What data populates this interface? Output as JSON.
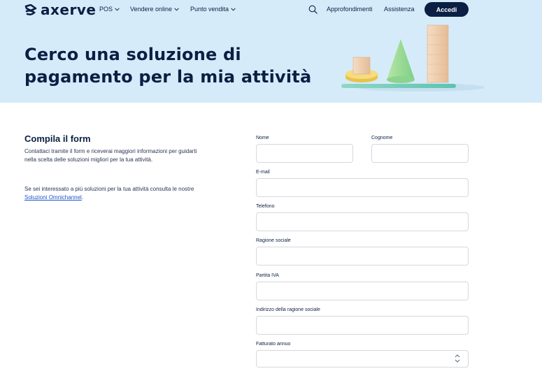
{
  "brand": {
    "name": "axerve"
  },
  "nav": {
    "items": [
      {
        "label": "POS"
      },
      {
        "label": "Vendere online"
      },
      {
        "label": "Punto vendita"
      }
    ],
    "links": [
      {
        "label": "Approfondimenti"
      },
      {
        "label": "Assistenza"
      }
    ],
    "login_label": "Accedi"
  },
  "hero": {
    "title_line1": "Cerco una soluzione di",
    "title_line2": "pagamento per la mia attività"
  },
  "intro": {
    "title": "Compila il form",
    "description": "Contattaci tramite il form e riceverai maggiori informazioni per guidarti nella scelta delle soluzioni migliori per la tua attività.",
    "omnichannel_prefix": "Se sei interessato a più soluzioni per la tua attività consulta le nostre ",
    "omnichannel_link": "Soluzioni Omnichannel",
    "omnichannel_suffix": "."
  },
  "form": {
    "nome": {
      "label": "Nome",
      "value": ""
    },
    "cognome": {
      "label": "Cognome",
      "value": ""
    },
    "email": {
      "label": "E-mail",
      "value": ""
    },
    "telefono": {
      "label": "Telefono",
      "value": ""
    },
    "ragione_sociale": {
      "label": "Ragione sociale",
      "value": ""
    },
    "partita_iva": {
      "label": "Partita IVA",
      "value": ""
    },
    "indirizzo": {
      "label": "Indirizzo della ragione sociale",
      "value": ""
    },
    "fatturato": {
      "label": "Fatturato annuo",
      "value": ""
    }
  },
  "colors": {
    "hero_bg": "#d6ebf9",
    "brand_navy": "#0b1f44",
    "link_blue": "#1a56c4",
    "field_border": "#d3d8e0"
  },
  "icons": {
    "logo": "axerve-logo-mark",
    "search": "search-icon",
    "dropdown": "chevron-down-icon",
    "select": "select-arrows-icon"
  }
}
